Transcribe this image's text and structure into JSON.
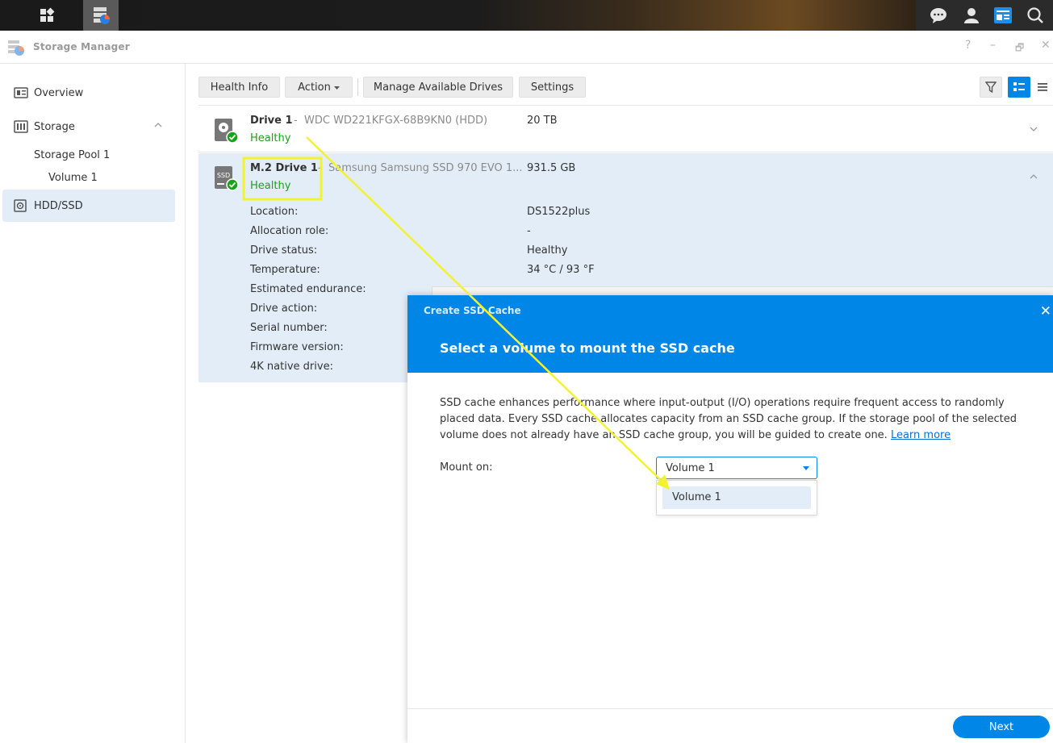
{
  "app": {
    "title": "Storage Manager"
  },
  "window_controls": {
    "help": "?",
    "minimize": "–",
    "restore": "🗗",
    "close": "✕"
  },
  "sidebar": {
    "items": [
      {
        "label": "Overview",
        "icon": "overview-icon"
      },
      {
        "label": "Storage",
        "icon": "storage-icon"
      },
      {
        "label": "HDD/SSD",
        "icon": "hdd-icon"
      }
    ],
    "sub": {
      "pool": "Storage Pool 1",
      "volume": "Volume 1"
    }
  },
  "toolbar": {
    "health_info": "Health Info",
    "action": "Action",
    "manage_drives": "Manage Available Drives",
    "settings": "Settings"
  },
  "drives": [
    {
      "name": "Drive 1",
      "separator": "-",
      "model": "WDC WD221KFGX-68B9KN0 (HDD)",
      "capacity": "20 TB",
      "status": "Healthy",
      "icon_label": ""
    },
    {
      "name": "M.2 Drive 1",
      "separator": "-",
      "model": "Samsung Samsung SSD 970 EVO 1...",
      "capacity": "931.5 GB",
      "status": "Healthy",
      "icon_label": "SSD"
    }
  ],
  "details": [
    {
      "label": "Location:",
      "value": "DS1522plus"
    },
    {
      "label": "Allocation role:",
      "value": "-"
    },
    {
      "label": "Drive status:",
      "value": "Healthy"
    },
    {
      "label": "Temperature:",
      "value": "34 °C / 93 °F"
    },
    {
      "label": "Estimated endurance:",
      "value": ""
    },
    {
      "label": "Drive action:",
      "value": ""
    },
    {
      "label": "Serial number:",
      "value": ""
    },
    {
      "label": "Firmware version:",
      "value": ""
    },
    {
      "label": "4K native drive:",
      "value": ""
    }
  ],
  "dialog": {
    "title": "Create SSD Cache",
    "heading": "Select a volume to mount the SSD cache",
    "description": "SSD cache enhances performance where input-output (I/O) operations require frequent access to randomly placed data. Every SSD cache allocates capacity from an SSD cache group. If the storage pool of the selected volume does not already have an SSD cache group, you will be guided to create one.",
    "learn_more": "Learn more",
    "mount_label": "Mount on:",
    "selected_volume": "Volume 1",
    "options": [
      "Volume 1"
    ],
    "next": "Next",
    "close": "✕"
  },
  "colors": {
    "accent": "#0086e6",
    "healthy": "#1aa31a",
    "highlight": "#f2f230",
    "selection": "#e3edf8"
  }
}
